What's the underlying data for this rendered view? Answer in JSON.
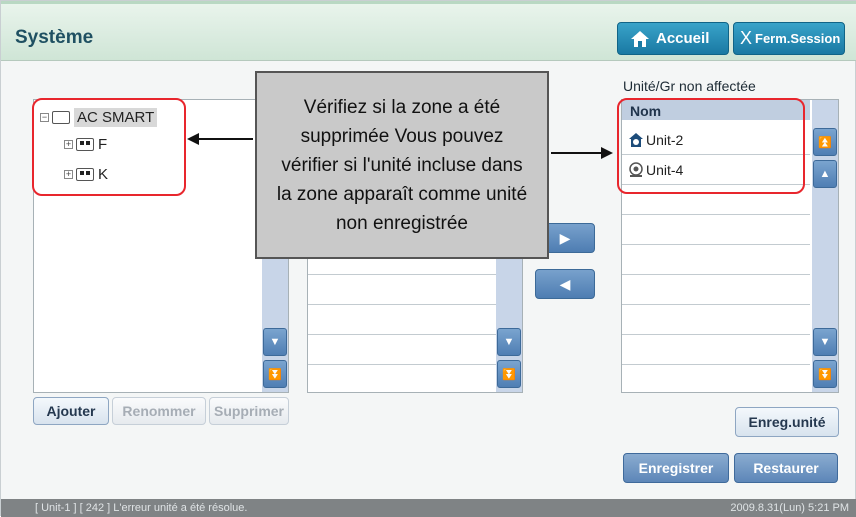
{
  "header": {
    "title": "Système",
    "home_label": "Accueil",
    "logout_label": "Ferm.Session"
  },
  "tree": {
    "root": "AC SMART",
    "children": [
      "F",
      "K"
    ]
  },
  "left_buttons": {
    "add": "Ajouter",
    "rename": "Renommer",
    "delete": "Supprimer"
  },
  "unassigned": {
    "title": "Unité/Gr non affectée",
    "column": "Nom",
    "items": [
      "Unit-2",
      "Unit-4"
    ]
  },
  "right_buttons": {
    "save_unit": "Enreg.unité",
    "save": "Enregistrer",
    "restore": "Restaurer"
  },
  "callout": [
    "Vérifiez si la zone a été",
    "supprimée Vous pouvez",
    "vérifier si l'unité incluse dans",
    "la zone apparaît comme unité",
    "non enregistrée"
  ],
  "status": {
    "message": "[ Unit-1 ] [ 242 ] L'erreur unité a été résolue.",
    "time": "2009.8.31(Lun) 5:21 PM"
  }
}
